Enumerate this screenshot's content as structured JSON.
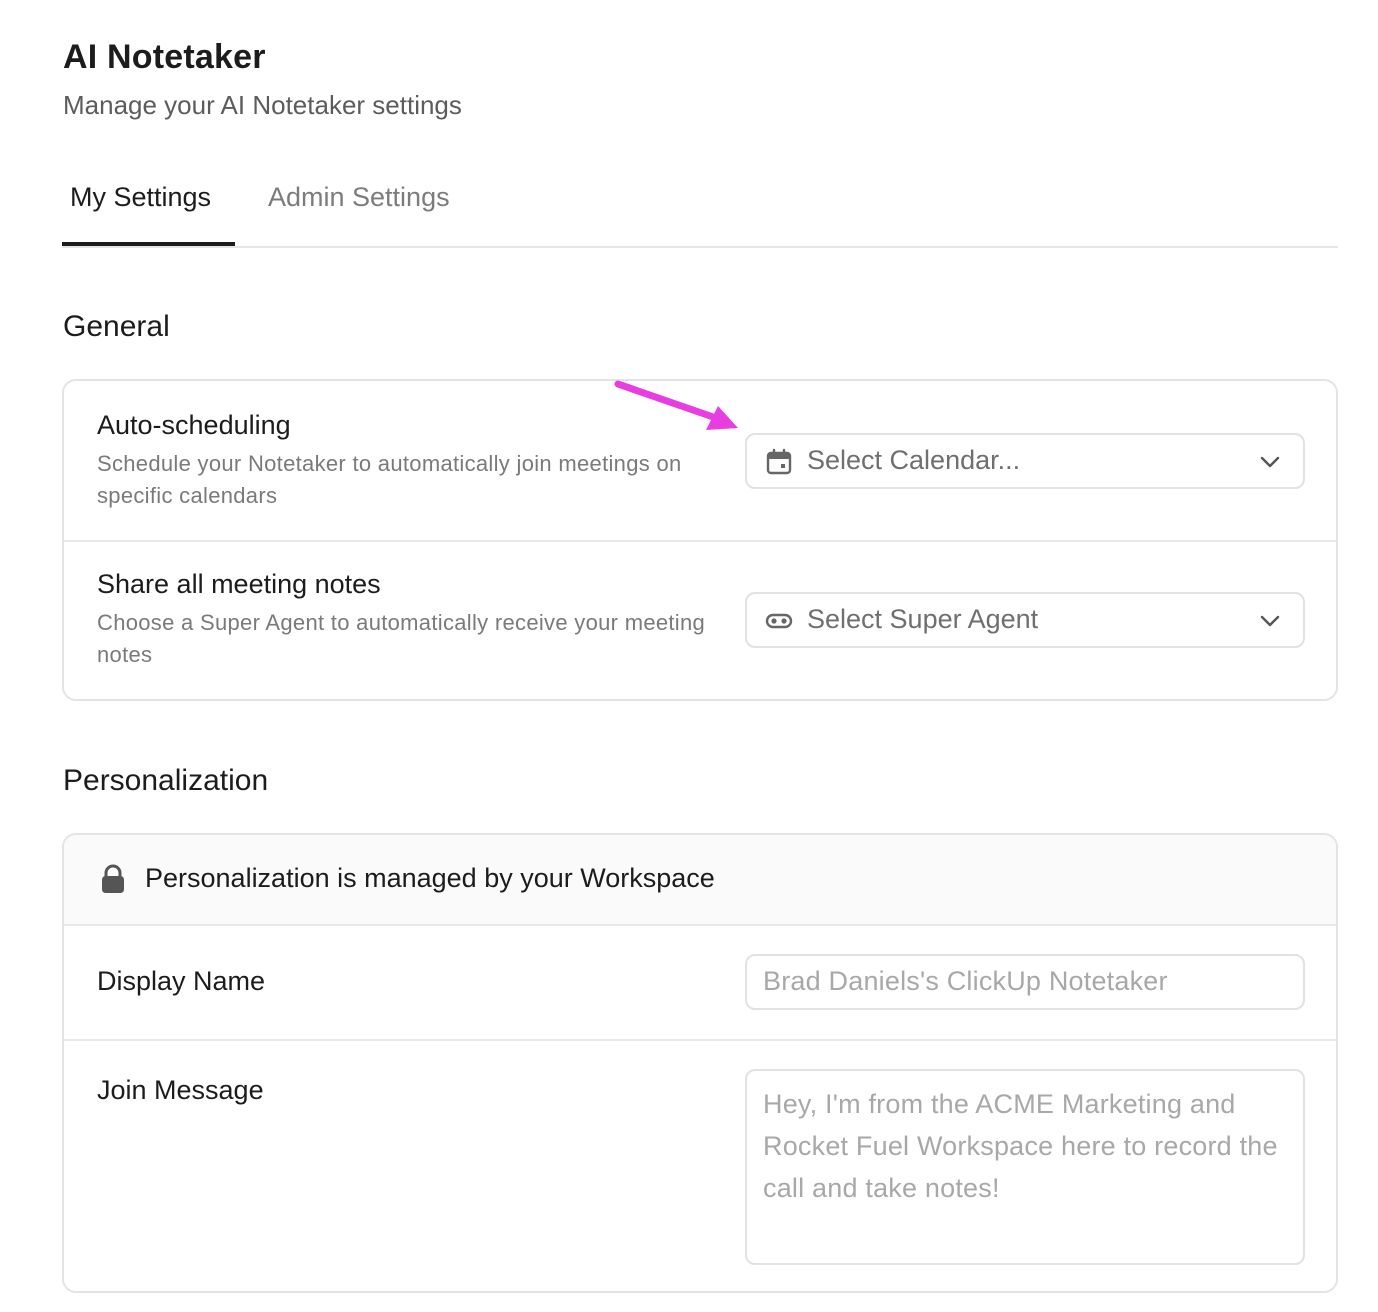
{
  "header": {
    "title": "AI Notetaker",
    "subtitle": "Manage your AI Notetaker settings"
  },
  "tabs": [
    {
      "label": "My Settings",
      "active": true
    },
    {
      "label": "Admin Settings",
      "active": false
    }
  ],
  "general": {
    "title": "General",
    "auto_scheduling": {
      "label": "Auto-scheduling",
      "description": "Schedule your Notetaker to automatically join meetings on specific calendars",
      "select_placeholder": "Select Calendar...",
      "icon": "calendar-icon"
    },
    "share_notes": {
      "label": "Share all meeting notes",
      "description": "Choose a Super Agent to automatically receive your meeting notes",
      "select_placeholder": "Select Super Agent",
      "icon": "super-agent-icon"
    }
  },
  "personalization": {
    "title": "Personalization",
    "notice": "Personalization is managed by your Workspace",
    "notice_icon": "lock-icon",
    "display_name": {
      "label": "Display Name",
      "value": "Brad Daniels's ClickUp Notetaker"
    },
    "join_message": {
      "label": "Join Message",
      "value": "Hey, I'm from the ACME Marketing and Rocket Fuel Workspace here to record the call and take notes!"
    }
  },
  "colors": {
    "annotation_arrow": "#e83de0",
    "text_primary": "#1c1c1c",
    "text_muted": "#7a7a7a",
    "border": "#e4e4e4"
  }
}
